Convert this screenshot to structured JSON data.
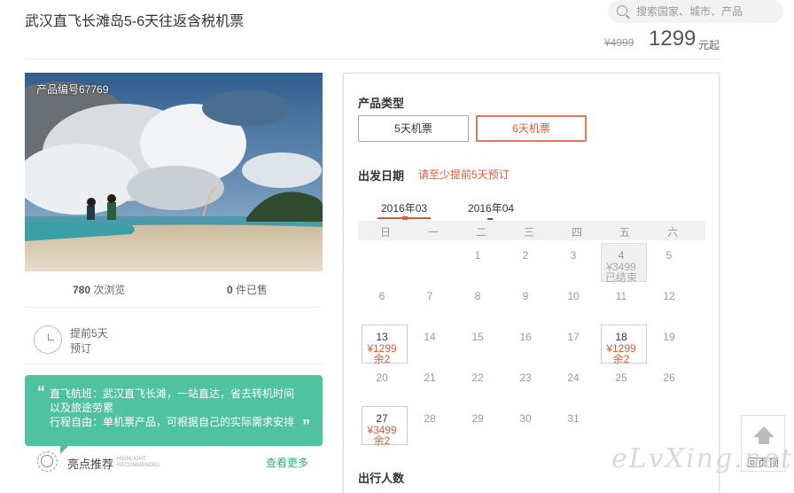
{
  "header": {
    "title": "武汉直飞长滩岛5-6天往返含税机票",
    "search_placeholder": "搜索国家、城市、产品",
    "old_price": "¥4999",
    "price": "1299",
    "price_suffix": "元起"
  },
  "product": {
    "code": "产品编号67769",
    "views_count": "780",
    "views_suffix": "次浏览",
    "sold_count": "0",
    "sold_suffix": "件已售",
    "advance_line1": "提前5天",
    "advance_line2": "预订"
  },
  "highlight": {
    "open_quote": "“",
    "close_quote": "”",
    "lines": [
      "直飞航班：武汉直飞长滩，一站直达，省去转机时间",
      "以及旅途劳累",
      "行程自由：单机票产品，可根据自己的实际需求安排"
    ],
    "label": "亮点推荐",
    "label_en_1": "HIGHLIGHT",
    "label_en_2": "RECOMMENDED",
    "more": "查看更多"
  },
  "booking": {
    "type_label": "产品类型",
    "types": [
      "5天机票",
      "6天机票"
    ],
    "date_label": "出发日期",
    "date_tip": "请至少提前5天预订",
    "months": [
      "2016年03",
      "2016年04"
    ],
    "weekdays": [
      "日",
      "一",
      "二",
      "三",
      "四",
      "五",
      "六"
    ],
    "travelers_label": "出行人数"
  },
  "calendar": {
    "rows": [
      [
        {
          "d": ""
        },
        {
          "d": ""
        },
        {
          "d": "1"
        },
        {
          "d": "2"
        },
        {
          "d": "3"
        },
        {
          "d": "4",
          "p": "¥3499",
          "r": "已结束",
          "past": true
        },
        {
          "d": "5"
        }
      ],
      [
        {
          "d": "6"
        },
        {
          "d": "7"
        },
        {
          "d": "8"
        },
        {
          "d": "9"
        },
        {
          "d": "10"
        },
        {
          "d": "11"
        },
        {
          "d": "12"
        }
      ],
      [
        {
          "d": "13",
          "p": "¥1299",
          "r": "余2"
        },
        {
          "d": "14"
        },
        {
          "d": "15"
        },
        {
          "d": "16"
        },
        {
          "d": "17"
        },
        {
          "d": "18",
          "p": "¥1299",
          "r": "余2"
        },
        {
          "d": "19"
        }
      ],
      [
        {
          "d": "20"
        },
        {
          "d": "21"
        },
        {
          "d": "22"
        },
        {
          "d": "23"
        },
        {
          "d": "24"
        },
        {
          "d": "25"
        },
        {
          "d": "26"
        }
      ],
      [
        {
          "d": "27",
          "p": "¥3499",
          "r": "余2"
        },
        {
          "d": "28"
        },
        {
          "d": "29"
        },
        {
          "d": "30"
        },
        {
          "d": "31"
        },
        {
          "d": ""
        },
        {
          "d": ""
        }
      ]
    ]
  },
  "side": {
    "back_top": "回页顶",
    "watermark": "eLvXing.net"
  },
  "colors": {
    "accent": "#e05a3a",
    "highlight_bg": "#4fc2a0",
    "more_link": "#3aa987"
  }
}
